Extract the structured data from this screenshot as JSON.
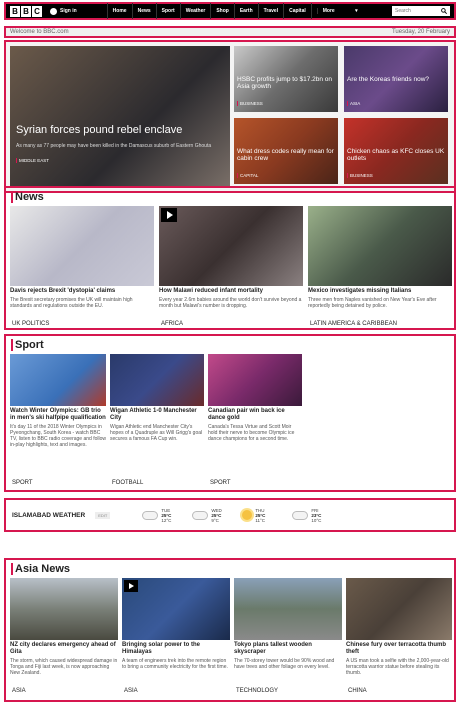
{
  "nav": {
    "logo": [
      "B",
      "B",
      "C"
    ],
    "signin": "Sign in",
    "items": [
      "Home",
      "News",
      "Sport",
      "Weather",
      "Shop",
      "Earth",
      "Travel",
      "Capital",
      "More"
    ],
    "more_arrow": "▾",
    "search_placeholder": "Search",
    "search_icon": "search-icon"
  },
  "welcome": {
    "text": "Welcome to BBC.com",
    "date": "Tuesday, 20 February"
  },
  "hero": {
    "main": {
      "title": "Syrian forces pound rebel enclave",
      "summary": "As many as 77 people may have been killed in the Damascus suburb of Eastern Ghouta",
      "category": "MIDDLE EAST"
    },
    "stories": [
      {
        "title": "HSBC profits jump to $17.2bn on Asia growth",
        "category": "BUSINESS"
      },
      {
        "title": "Are the Koreas friends now?",
        "category": "ASIA"
      },
      {
        "title": "What dress codes really mean for cabin crew",
        "category": "CAPITAL"
      },
      {
        "title": "Chicken chaos as KFC closes UK outlets",
        "category": "BUSINESS"
      }
    ]
  },
  "news": {
    "heading": "News",
    "items": [
      {
        "title": "Davis rejects Brexit 'dystopia' claims",
        "summary": "The Brexit secretary promises the UK will maintain high standards and regulations outside the EU.",
        "category": "UK POLITICS"
      },
      {
        "title": "How Malawi reduced infant mortality",
        "summary": "Every year 2.6m babies around the world don't survive beyond a month but Malawi's number is dropping.",
        "category": "AFRICA"
      },
      {
        "title": "Mexico investigates missing Italians",
        "summary": "Three men from Naples vanished on New Year's Eve after reportedly being detained by police.",
        "category": "LATIN AMERICA & CARIBBEAN"
      }
    ]
  },
  "sport": {
    "heading": "Sport",
    "items": [
      {
        "title": "Watch Winter Olympics: GB trio in men's ski halfpipe qualification",
        "summary": "It's day 11 of the 2018 Winter Olympics in Pyeongchang, South Korea - watch BBC TV, listen to BBC radio coverage and follow in-play highlights, text and images.",
        "category": "SPORT"
      },
      {
        "title": "Wigan Athletic 1-0 Manchester City",
        "summary": "Wigan Athletic end Manchester City's hopes of a Quadruple as Will Grigg's goal secures a famous FA Cup win.",
        "category": "FOOTBALL"
      },
      {
        "title": "Canadian pair win back ice dance gold",
        "summary": "Canada's Tessa Virtue and Scott Moir hold their nerve to become Olympic ice dance champions for a second time.",
        "category": "SPORT"
      }
    ]
  },
  "weather": {
    "label": "ISLAMABAD WEATHER",
    "edit": "EDIT",
    "days": [
      {
        "day": "TUE",
        "high": "25°C",
        "low": "12°C",
        "icon": "cloud-icon"
      },
      {
        "day": "WED",
        "high": "25°C",
        "low": "9°C",
        "icon": "cloud-icon"
      },
      {
        "day": "THU",
        "high": "25°C",
        "low": "11°C",
        "icon": "sun-icon"
      },
      {
        "day": "FRI",
        "high": "23°C",
        "low": "10°C",
        "icon": "cloud-icon"
      }
    ]
  },
  "asia": {
    "heading": "Asia News",
    "items": [
      {
        "title": "NZ city declares emergency ahead of Gita",
        "summary": "The storm, which caused widespread damage in Tonga and Fiji last week, is now approaching New Zealand.",
        "category": "ASIA"
      },
      {
        "title": "Bringing solar power to the Himalayas",
        "summary": "A team of engineers trek into the remote region to bring a community electricity for the first time.",
        "category": "ASIA"
      },
      {
        "title": "Tokyo plans tallest wooden skyscraper",
        "summary": "The 70-storey tower would be 90% wood and have trees and other foliage on every level.",
        "category": "TECHNOLOGY"
      },
      {
        "title": "Chinese fury over terracotta thumb theft",
        "summary": "A US man took a selfie with the 2,000-year-old terracotta warrior statue before stealing its thumb.",
        "category": "CHINA"
      }
    ]
  }
}
